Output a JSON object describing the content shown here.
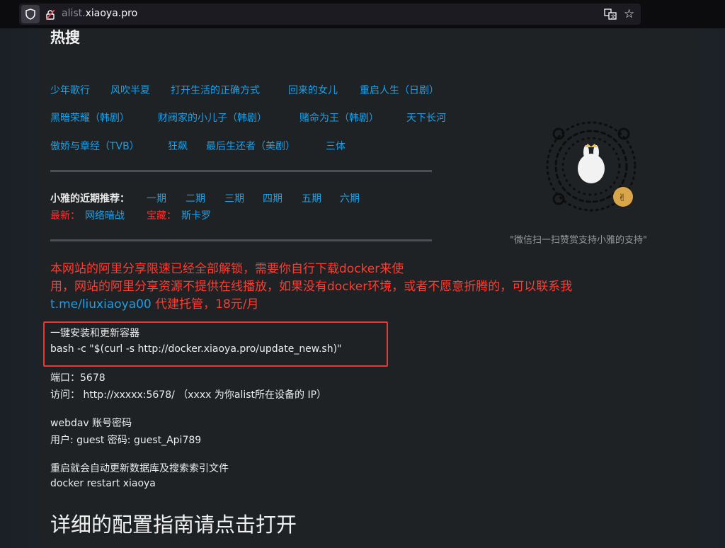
{
  "browser": {
    "url_prefix": "alist.",
    "url_domain": "xiaoya.pro"
  },
  "page": {
    "title": "热搜",
    "hot_rows": [
      [
        "少年歌行",
        "风吹半夏",
        "打开生活的正确方式",
        "回来的女儿",
        "重启人生（日剧）"
      ],
      [
        "黑暗荣耀（韩剧）",
        "财阀家的小儿子（韩剧）",
        "赌命为王（韩剧）",
        "天下长河"
      ],
      [
        "傲娇与章经（TVB）",
        "狂飙",
        "最后生还者（美剧）",
        "三体"
      ]
    ],
    "recommend_label": "小雅的近期推荐：",
    "episodes": [
      "一期",
      "二期",
      "三期",
      "四期",
      "五期",
      "六期"
    ],
    "latest_label": "最新：",
    "latest_link": "网络暗战",
    "treasure_label": "宝藏：",
    "treasure_link": "斯卡罗",
    "notice_line1": "本网站的阿里分享限速已经全部解锁，需要你自行下载docker来使",
    "notice_line2": "用，网站的阿里分享资源不提供在线播放，如果没有docker环境，或者不愿意折腾的，可以联系我",
    "notice_link": "t.me/liuxiaoya00",
    "notice_tail": " 代建托管，18元/月",
    "install_title": "一键安装和更新容器",
    "install_cmd": "bash -c \"$(curl -s http://docker.xiaoya.pro/update_new.sh)\"",
    "port_line": "端口：5678",
    "visit_line": "访问： http://xxxxx:5678/ （xxxx 为你alist所在设备的 IP）",
    "webdav_title": "webdav 账号密码",
    "webdav_creds": "用户: guest 密码: guest_Api789",
    "restart_title": "重启就会自动更新数据库及搜索索引文件",
    "restart_cmd": "docker restart xiaoya",
    "guide_link": "详细的配置指南请点击打开",
    "qr_caption": "\"微信扫一扫赞赏支持小雅的支持\""
  },
  "colors": {
    "link": "#1e9fe4",
    "warning": "#ff3b2f",
    "highlight_border": "#e53935"
  }
}
